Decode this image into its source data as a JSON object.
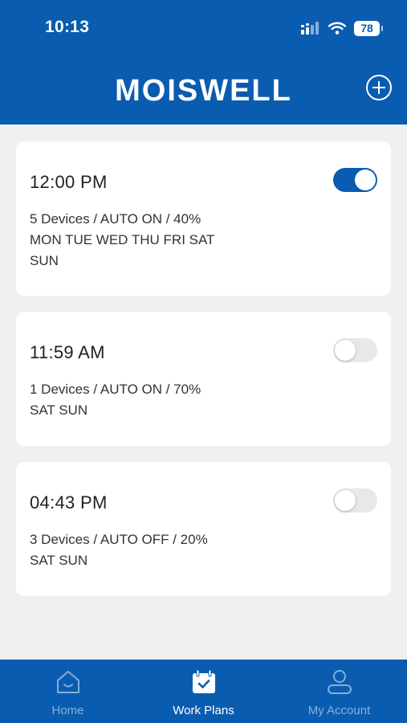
{
  "status_bar": {
    "time": "10:13",
    "battery": "78"
  },
  "header": {
    "brand": "MOISWELL"
  },
  "plans": [
    {
      "time": "12:00 PM",
      "summary": "5 Devices / AUTO ON / 40%",
      "days": "MON TUE WED THU FRI SAT SUN",
      "enabled": true
    },
    {
      "time": "11:59 AM",
      "summary": "1 Devices / AUTO ON / 70%",
      "days": "SAT SUN",
      "enabled": false
    },
    {
      "time": "04:43 PM",
      "summary": "3 Devices / AUTO OFF / 20%",
      "days": "SAT SUN",
      "enabled": false
    }
  ],
  "tabs": [
    {
      "label": "Home",
      "icon": "home-icon",
      "active": false
    },
    {
      "label": "Work Plans",
      "icon": "calendar-check-icon",
      "active": true
    },
    {
      "label": "My Account",
      "icon": "user-icon",
      "active": false
    }
  ],
  "colors": {
    "primary": "#0a5cb0",
    "background": "#f0f0f2",
    "card": "#ffffff"
  }
}
